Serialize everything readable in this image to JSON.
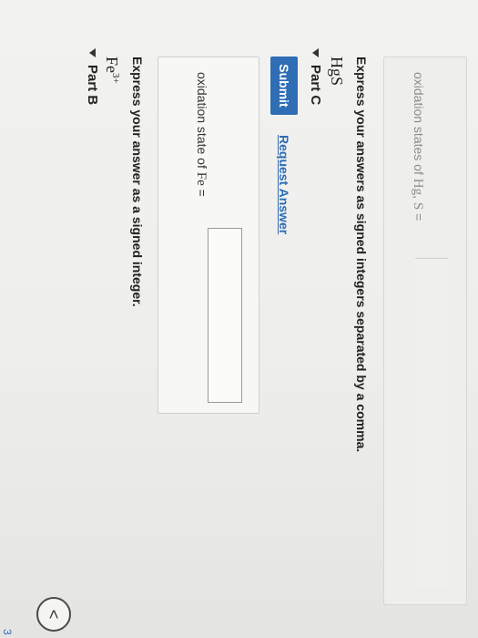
{
  "partB": {
    "header": "Part B",
    "formula_base": "Fe",
    "formula_charge": "3+",
    "instruction": "Express your answer as a signed integer.",
    "answer_label_prefix": "oxidation state of",
    "answer_label_element": "Fe",
    "answer_label_suffix": "=",
    "submit_label": "Submit",
    "request_label": "Request Answer"
  },
  "partC": {
    "header": "Part C",
    "formula_el1": "Hg",
    "formula_sub1": "",
    "formula_el2": "S",
    "instruction": "Express your answers as signed integers separated by a comma.",
    "answer_label_prefix": "oxidation states of",
    "answer_label_el1": "Hg",
    "answer_label_sep": ",",
    "answer_label_el2": "S",
    "answer_label_suffix": "="
  },
  "nav": {
    "button_glyph": "<",
    "page": "3"
  }
}
